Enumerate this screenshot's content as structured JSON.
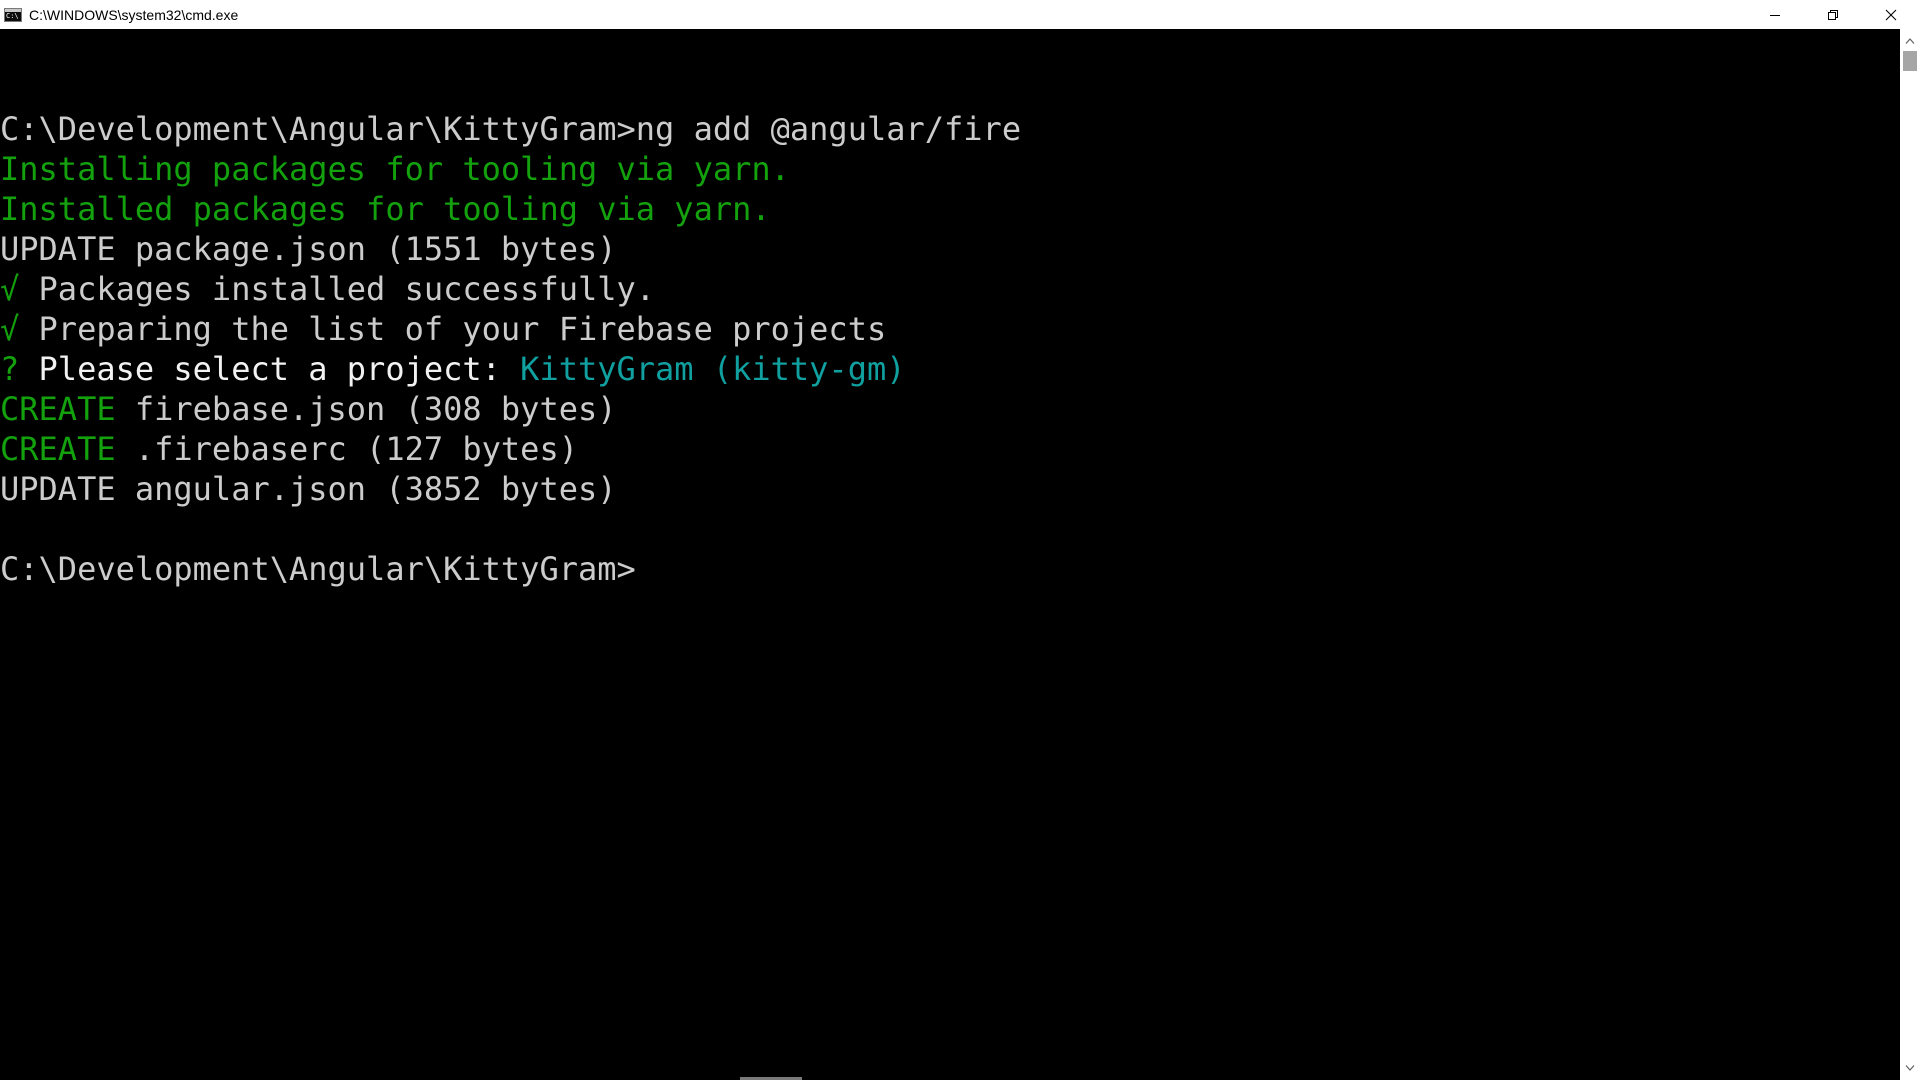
{
  "window": {
    "title": "C:\\WINDOWS\\system32\\cmd.exe",
    "icons": {
      "app": "cmd-icon",
      "minimize": "minimize-icon",
      "restore": "restore-icon",
      "close": "close-icon"
    }
  },
  "colors": {
    "background": "#000000",
    "default_text": "#cccccc",
    "green": "#13a10e",
    "cyan": "#11a0a0",
    "white": "#f2f2f2"
  },
  "console": {
    "lines": [
      [
        {
          "text": "",
          "color": "default"
        }
      ],
      [
        {
          "text": "C:\\Development\\Angular\\KittyGram>ng add @angular/fire",
          "color": "default"
        }
      ],
      [
        {
          "text": "Installing packages for tooling via yarn.",
          "color": "green"
        }
      ],
      [
        {
          "text": "Installed packages for tooling via yarn.",
          "color": "green"
        }
      ],
      [
        {
          "text": "UPDATE package.json (1551 bytes)",
          "color": "default"
        }
      ],
      [
        {
          "text": "√",
          "color": "green"
        },
        {
          "text": " Packages installed successfully.",
          "color": "default"
        }
      ],
      [
        {
          "text": "√",
          "color": "green"
        },
        {
          "text": " Preparing the list of your Firebase projects",
          "color": "default"
        }
      ],
      [
        {
          "text": "?",
          "color": "green"
        },
        {
          "text": " Please select a project: ",
          "color": "white"
        },
        {
          "text": "KittyGram (kitty-gm)",
          "color": "cyan2"
        }
      ],
      [
        {
          "text": "CREATE",
          "color": "green"
        },
        {
          "text": " firebase.json (308 bytes)",
          "color": "default"
        }
      ],
      [
        {
          "text": "CREATE",
          "color": "green"
        },
        {
          "text": " .firebaserc (127 bytes)",
          "color": "default"
        }
      ],
      [
        {
          "text": "UPDATE angular.json (3852 bytes)",
          "color": "default"
        }
      ],
      [
        {
          "text": "",
          "color": "default"
        }
      ],
      [
        {
          "text": "C:\\Development\\Angular\\KittyGram>",
          "color": "default"
        }
      ]
    ]
  },
  "scrollbar": {
    "up_icon": "scroll-up-arrow-icon",
    "down_icon": "scroll-down-arrow-icon"
  }
}
